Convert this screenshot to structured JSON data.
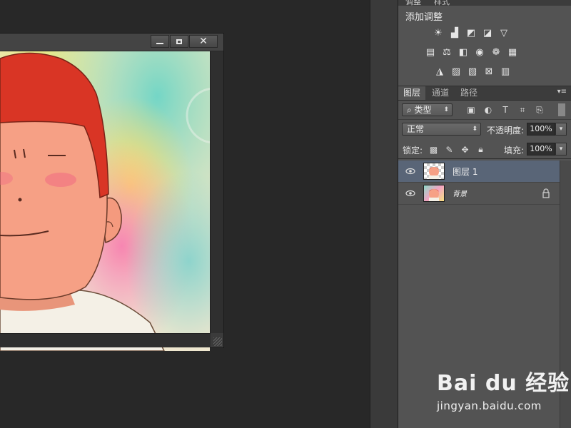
{
  "top_tabs": [
    "调整",
    "样式"
  ],
  "adjustments": {
    "title": "添加调整",
    "row1": [
      "brightness-icon",
      "levels-icon",
      "curves-icon",
      "exposure-icon",
      "gradient-triangle-icon"
    ],
    "row2": [
      "vibrance-icon",
      "balance-icon",
      "bw-icon",
      "photo-filter-icon",
      "channel-mixer-icon",
      "lookup-icon"
    ],
    "row3": [
      "invert-icon",
      "posterize-icon",
      "threshold-icon",
      "selective-color-icon",
      "gradient-map-icon"
    ]
  },
  "layers_panel": {
    "tabs": [
      "图层",
      "通道",
      "路径"
    ],
    "filter": {
      "label": "类型"
    },
    "blend_mode": "正常",
    "opacity_label": "不透明度:",
    "opacity_value": "100%",
    "lock_label": "锁定:",
    "fill_label": "填充:",
    "fill_value": "100%",
    "layers": [
      {
        "name": "图层 1",
        "selected": true,
        "locked": false
      },
      {
        "name": "背景",
        "selected": false,
        "locked": true
      }
    ]
  },
  "watermark": {
    "brand": "Bai du 经验",
    "url": "jingyan.baidu.com"
  },
  "colors": {
    "panel": "#535353",
    "selected": "#596577",
    "dark": "#282828"
  }
}
